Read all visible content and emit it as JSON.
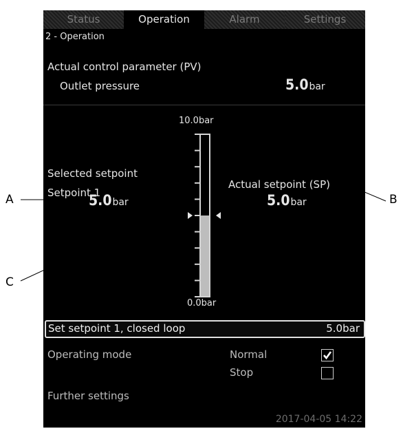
{
  "tabs": [
    {
      "label": "Status",
      "active": false
    },
    {
      "label": "Operation",
      "active": true
    },
    {
      "label": "Alarm",
      "active": false
    },
    {
      "label": "Settings",
      "active": false
    }
  ],
  "breadcrumb": "2 - Operation",
  "control_parameter": {
    "heading": "Actual control parameter (PV)",
    "label": "Outlet pressure",
    "value": "5.0",
    "unit": "bar"
  },
  "scale": {
    "top_label": "10.0bar",
    "bottom_label": "0.0bar",
    "min": 0,
    "max": 10,
    "fill_value": 5.0,
    "marker_value": 5.0
  },
  "selected_setpoint": {
    "label": "Selected setpoint",
    "name": "Setpoint 1",
    "value": "5.0",
    "unit": "bar"
  },
  "actual_setpoint": {
    "label": "Actual setpoint (SP)",
    "value": "5.0",
    "unit": "bar"
  },
  "set_setpoint_row": {
    "label": "Set setpoint 1, closed loop",
    "value": "5.0bar"
  },
  "operating_mode": {
    "label": "Operating mode",
    "options": [
      {
        "label": "Normal",
        "checked": true
      },
      {
        "label": "Stop",
        "checked": false
      }
    ]
  },
  "further_settings": "Further settings",
  "datetime": "2017-04-05 14:22",
  "callouts": {
    "a": "A",
    "b": "B",
    "c": "C"
  },
  "colors": {
    "screen_bg": "#000000",
    "text": "#e6e6e6",
    "bar_fill": "#bdbdbd",
    "highlight_border": "#e0e0e0"
  }
}
